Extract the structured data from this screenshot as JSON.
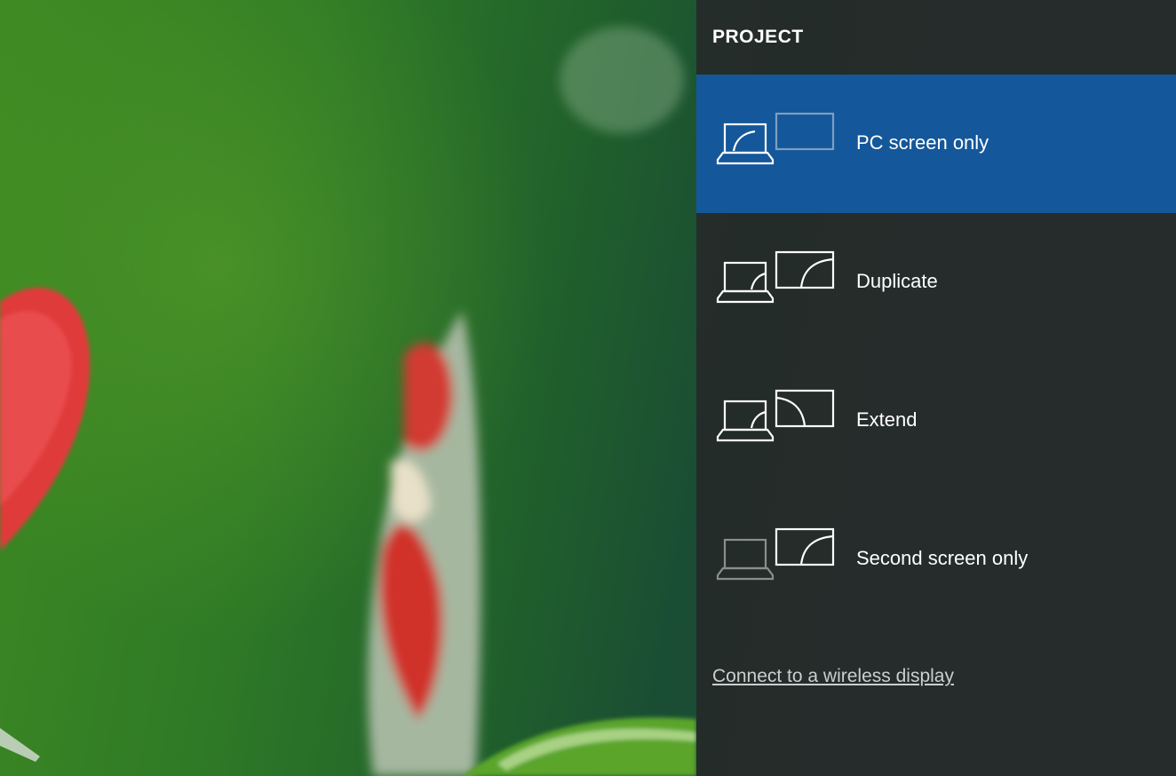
{
  "panel": {
    "title": "PROJECT",
    "options": [
      {
        "label": "PC screen only",
        "icon": "pc-screen-only-icon",
        "selected": true
      },
      {
        "label": "Duplicate",
        "icon": "duplicate-icon",
        "selected": false
      },
      {
        "label": "Extend",
        "icon": "extend-icon",
        "selected": false
      },
      {
        "label": "Second screen only",
        "icon": "second-screen-only-icon",
        "selected": false
      }
    ],
    "wireless_link": "Connect to a wireless display"
  },
  "colors": {
    "selected_background": "#14579a",
    "panel_background": "#262a2a",
    "text": "#ffffff",
    "dimmed_icon": "#8a8e8e",
    "link": "#c9cfcf"
  }
}
